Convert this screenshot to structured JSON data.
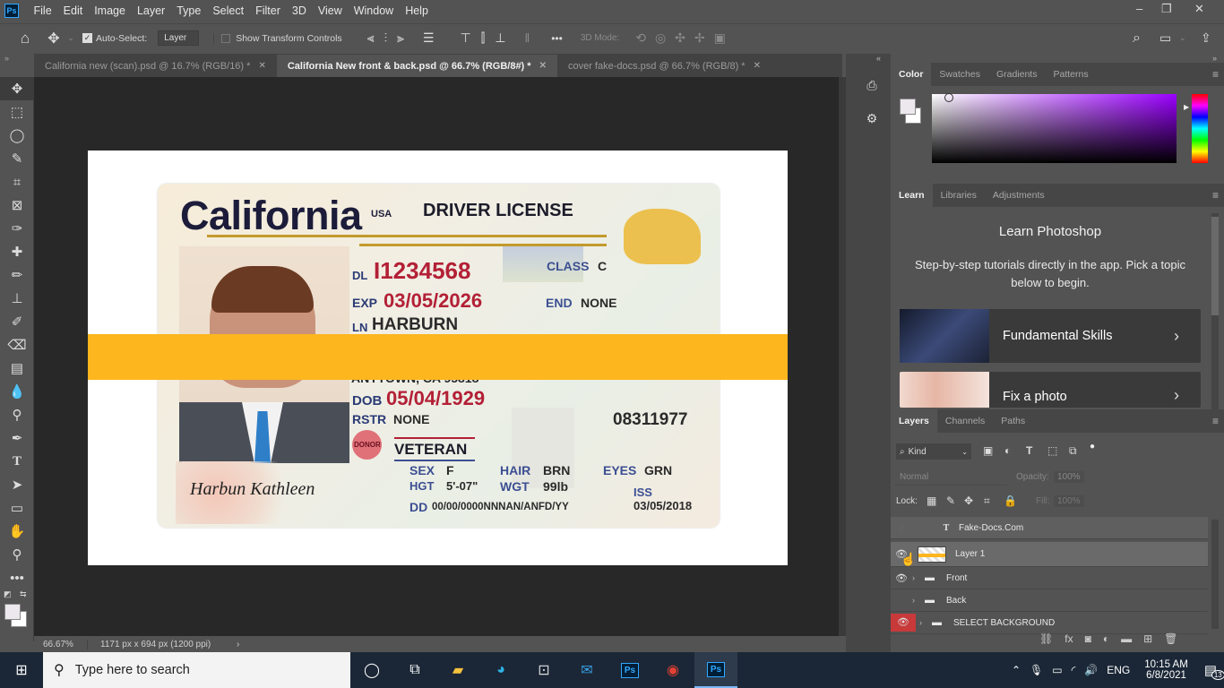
{
  "app": {
    "logo": "Ps",
    "menu": [
      "File",
      "Edit",
      "Image",
      "Layer",
      "Type",
      "Select",
      "Filter",
      "3D",
      "View",
      "Window",
      "Help"
    ],
    "window_controls": {
      "minimize": "–",
      "restore": "❐",
      "close": "✕"
    }
  },
  "options_bar": {
    "auto_select_label": "Auto-Select:",
    "auto_select_checked": true,
    "auto_select_target": "Layer",
    "show_transform_label": "Show Transform Controls",
    "show_transform_checked": false,
    "mode_label": "3D Mode:",
    "more_label": "•••"
  },
  "doc_tabs": [
    {
      "label": "California new (scan).psd @ 16.7% (RGB/16) *",
      "active": false
    },
    {
      "label": "California New front & back.psd @ 66.7% (RGB/8#) *",
      "active": true
    },
    {
      "label": "cover fake-docs.psd @ 66.7% (RGB/8) *",
      "active": false
    }
  ],
  "tools": [
    "move-icon",
    "marquee-icon",
    "lasso-icon",
    "quick-select-icon",
    "crop-icon",
    "frame-icon",
    "eyedropper-icon",
    "healing-icon",
    "brush-icon",
    "stamp-icon",
    "history-brush-icon",
    "eraser-icon",
    "gradient-icon",
    "blur-icon",
    "dodge-icon",
    "pen-icon",
    "type-icon",
    "path-select-icon",
    "rectangle-icon",
    "hand-icon",
    "zoom-icon",
    "more-tools-icon"
  ],
  "card": {
    "state": "California",
    "country": "USA",
    "title": "DRIVER LICENSE",
    "dl_label": "DL",
    "dl_value": "I1234568",
    "class_label": "CLASS",
    "class_value": "C",
    "exp_label": "EXP",
    "exp_value": "03/05/2026",
    "end_label": "END",
    "end_value": "NONE",
    "ln_label": "LN",
    "ln_value": "HARBURN",
    "address_partial": "ANYTOWN, CA 95818",
    "dob_label": "DOB",
    "dob_value": "05/04/1929",
    "rstr_label": "RSTR",
    "rstr_value": "NONE",
    "donor": "DONOR",
    "veteran": "VETERAN",
    "number": "08311977",
    "sex_label": "SEX",
    "sex_value": "F",
    "hair_label": "HAIR",
    "hair_value": "BRN",
    "eyes_label": "EYES",
    "eyes_value": "GRN",
    "hgt_label": "HGT",
    "hgt_value": "5'-07\"",
    "wgt_label": "WGT",
    "wgt_value": "99lb",
    "iss_label": "ISS",
    "iss_value": "03/05/2018",
    "dd_label": "DD",
    "dd_value": "00/00/0000NNNAN/ANFD/YY",
    "signature": "Harbun Kathleen"
  },
  "status_bar": {
    "zoom": "66.67%",
    "doc_info": "1171 px x 694 px (1200 ppi)",
    "arrow": "›"
  },
  "color_panel": {
    "tabs": [
      "Color",
      "Swatches",
      "Gradients",
      "Patterns"
    ],
    "active_tab": "Color",
    "hue_color": "#9b00ff"
  },
  "learn_panel": {
    "tabs": [
      "Learn",
      "Libraries",
      "Adjustments"
    ],
    "active_tab": "Learn",
    "title": "Learn Photoshop",
    "subtitle": "Step-by-step tutorials directly in the app. Pick a topic below to begin.",
    "cards": [
      {
        "label": "Fundamental Skills"
      },
      {
        "label": "Fix a photo"
      }
    ]
  },
  "layers_panel": {
    "tabs": [
      "Layers",
      "Channels",
      "Paths"
    ],
    "active_tab": "Layers",
    "filter_label": "Kind",
    "blend_mode": "Normal",
    "opacity_label": "Opacity:",
    "opacity_value": "100%",
    "lock_label": "Lock:",
    "fill_label": "Fill:",
    "fill_value": "100%",
    "layers": [
      {
        "name": "Fake-Docs.Com",
        "type": "text",
        "visible": false,
        "selected": false
      },
      {
        "name": "Layer 1",
        "type": "pixel",
        "visible": true,
        "selected": true
      },
      {
        "name": "Front",
        "type": "group",
        "visible": true,
        "selected": false
      },
      {
        "name": "Back",
        "type": "group",
        "visible": false,
        "selected": false
      },
      {
        "name": "SELECT BACKGROUND",
        "type": "group",
        "visible": true,
        "selected": false,
        "color_tag": "#c8393a"
      }
    ]
  },
  "taskbar": {
    "search_placeholder": "Type here to search",
    "time": "10:15 AM",
    "date": "6/8/2021",
    "language": "ENG",
    "notifications": "13"
  }
}
